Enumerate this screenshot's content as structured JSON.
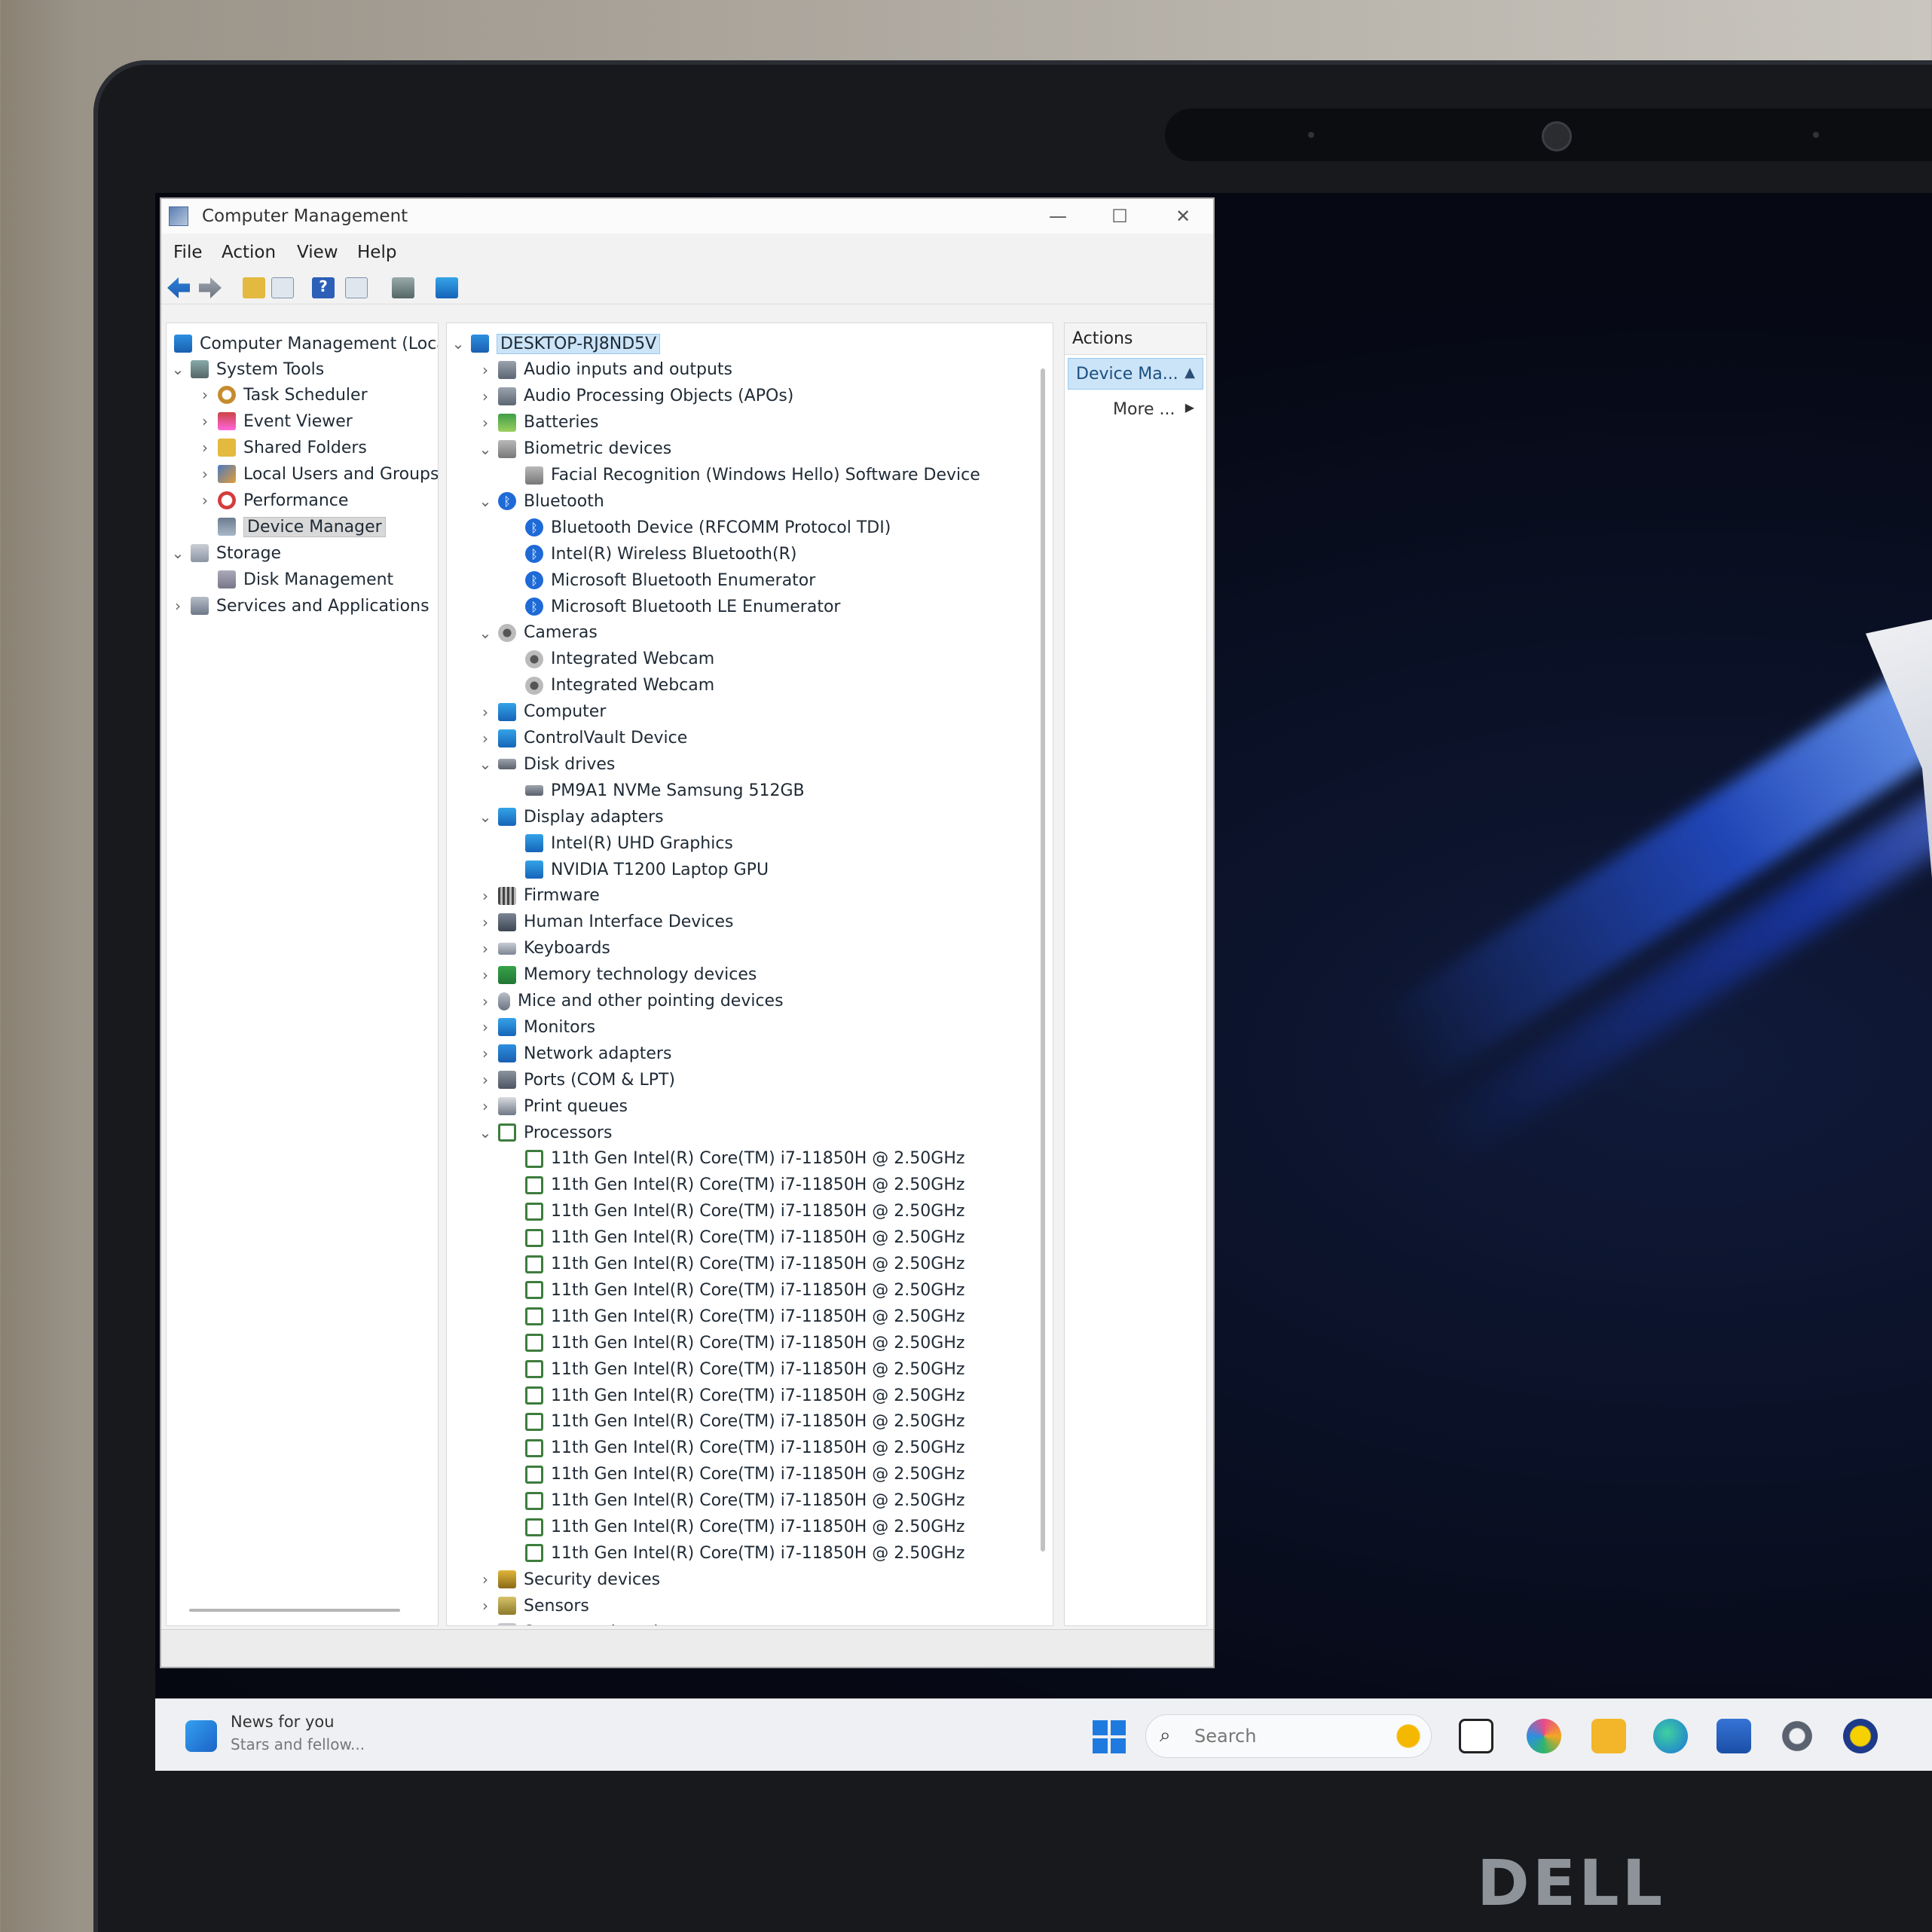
{
  "window": {
    "title": "Computer Management",
    "controls": {
      "minimize": "—",
      "maximize": "☐",
      "close": "✕"
    }
  },
  "menu": [
    "File",
    "Action",
    "View",
    "Help"
  ],
  "left_tree": [
    {
      "label": "Computer Management (Local",
      "level": 0,
      "chevron": "",
      "icon": "computer-icon"
    },
    {
      "label": "System Tools",
      "level": 1,
      "chevron": "⌄",
      "icon": "tools-icon"
    },
    {
      "label": "Task Scheduler",
      "level": 2,
      "chevron": "›",
      "icon": "clock-icon"
    },
    {
      "label": "Event Viewer",
      "level": 2,
      "chevron": "›",
      "icon": "event-icon"
    },
    {
      "label": "Shared Folders",
      "level": 2,
      "chevron": "›",
      "icon": "folder-icon"
    },
    {
      "label": "Local Users and Groups",
      "level": 2,
      "chevron": "›",
      "icon": "users-icon"
    },
    {
      "label": "Performance",
      "level": 2,
      "chevron": "›",
      "icon": "performance-icon"
    },
    {
      "label": "Device Manager",
      "level": 2,
      "chevron": "",
      "icon": "device-manager-icon",
      "selected": true
    },
    {
      "label": "Storage",
      "level": 1,
      "chevron": "⌄",
      "icon": "storage-icon"
    },
    {
      "label": "Disk Management",
      "level": 2,
      "chevron": "",
      "icon": "disk-icon"
    },
    {
      "label": "Services and Applications",
      "level": 1,
      "chevron": "›",
      "icon": "services-icon"
    }
  ],
  "device_tree": [
    {
      "label": "DESKTOP-RJ8ND5V",
      "level": 0,
      "chevron": "⌄",
      "icon": "computer-icon",
      "selected": true
    },
    {
      "label": "Audio inputs and outputs",
      "level": 1,
      "chevron": "›",
      "icon": "speaker-icon"
    },
    {
      "label": "Audio Processing Objects (APOs)",
      "level": 1,
      "chevron": "›",
      "icon": "speaker-icon"
    },
    {
      "label": "Batteries",
      "level": 1,
      "chevron": "›",
      "icon": "battery-icon"
    },
    {
      "label": "Biometric devices",
      "level": 1,
      "chevron": "⌄",
      "icon": "biometric-icon"
    },
    {
      "label": "Facial Recognition (Windows Hello) Software Device",
      "level": 2,
      "chevron": "",
      "icon": "biometric-icon"
    },
    {
      "label": "Bluetooth",
      "level": 1,
      "chevron": "⌄",
      "icon": "bluetooth-icon"
    },
    {
      "label": "Bluetooth Device (RFCOMM Protocol TDI)",
      "level": 2,
      "chevron": "",
      "icon": "bluetooth-icon"
    },
    {
      "label": "Intel(R) Wireless Bluetooth(R)",
      "level": 2,
      "chevron": "",
      "icon": "bluetooth-icon"
    },
    {
      "label": "Microsoft Bluetooth Enumerator",
      "level": 2,
      "chevron": "",
      "icon": "bluetooth-icon"
    },
    {
      "label": "Microsoft Bluetooth LE Enumerator",
      "level": 2,
      "chevron": "",
      "icon": "bluetooth-icon"
    },
    {
      "label": "Cameras",
      "level": 1,
      "chevron": "⌄",
      "icon": "camera-icon"
    },
    {
      "label": "Integrated Webcam",
      "level": 2,
      "chevron": "",
      "icon": "camera-icon"
    },
    {
      "label": "Integrated Webcam",
      "level": 2,
      "chevron": "",
      "icon": "camera-icon"
    },
    {
      "label": "Computer",
      "level": 1,
      "chevron": "›",
      "icon": "monitor-icon"
    },
    {
      "label": "ControlVault Device",
      "level": 1,
      "chevron": "›",
      "icon": "monitor-icon"
    },
    {
      "label": "Disk drives",
      "level": 1,
      "chevron": "⌄",
      "icon": "drive-icon"
    },
    {
      "label": "PM9A1 NVMe Samsung 512GB",
      "level": 2,
      "chevron": "",
      "icon": "drive-icon"
    },
    {
      "label": "Display adapters",
      "level": 1,
      "chevron": "⌄",
      "icon": "monitor-icon"
    },
    {
      "label": "Intel(R) UHD Graphics",
      "level": 2,
      "chevron": "",
      "icon": "monitor-icon"
    },
    {
      "label": "NVIDIA T1200 Laptop GPU",
      "level": 2,
      "chevron": "",
      "icon": "monitor-icon"
    },
    {
      "label": "Firmware",
      "level": 1,
      "chevron": "›",
      "icon": "firmware-icon"
    },
    {
      "label": "Human Interface Devices",
      "level": 1,
      "chevron": "›",
      "icon": "hid-icon"
    },
    {
      "label": "Keyboards",
      "level": 1,
      "chevron": "›",
      "icon": "keyboard-icon"
    },
    {
      "label": "Memory technology devices",
      "level": 1,
      "chevron": "›",
      "icon": "memory-icon"
    },
    {
      "label": "Mice and other pointing devices",
      "level": 1,
      "chevron": "›",
      "icon": "mouse-icon"
    },
    {
      "label": "Monitors",
      "level": 1,
      "chevron": "›",
      "icon": "monitor-icon"
    },
    {
      "label": "Network adapters",
      "level": 1,
      "chevron": "›",
      "icon": "network-icon"
    },
    {
      "label": "Ports (COM & LPT)",
      "level": 1,
      "chevron": "›",
      "icon": "port-icon"
    },
    {
      "label": "Print queues",
      "level": 1,
      "chevron": "›",
      "icon": "printer-icon"
    },
    {
      "label": "Processors",
      "level": 1,
      "chevron": "⌄",
      "icon": "processor-icon"
    },
    {
      "label": "11th Gen Intel(R) Core(TM) i7-11850H @ 2.50GHz",
      "level": 2,
      "chevron": "",
      "icon": "processor-icon"
    },
    {
      "label": "11th Gen Intel(R) Core(TM) i7-11850H @ 2.50GHz",
      "level": 2,
      "chevron": "",
      "icon": "processor-icon"
    },
    {
      "label": "11th Gen Intel(R) Core(TM) i7-11850H @ 2.50GHz",
      "level": 2,
      "chevron": "",
      "icon": "processor-icon"
    },
    {
      "label": "11th Gen Intel(R) Core(TM) i7-11850H @ 2.50GHz",
      "level": 2,
      "chevron": "",
      "icon": "processor-icon"
    },
    {
      "label": "11th Gen Intel(R) Core(TM) i7-11850H @ 2.50GHz",
      "level": 2,
      "chevron": "",
      "icon": "processor-icon"
    },
    {
      "label": "11th Gen Intel(R) Core(TM) i7-11850H @ 2.50GHz",
      "level": 2,
      "chevron": "",
      "icon": "processor-icon"
    },
    {
      "label": "11th Gen Intel(R) Core(TM) i7-11850H @ 2.50GHz",
      "level": 2,
      "chevron": "",
      "icon": "processor-icon"
    },
    {
      "label": "11th Gen Intel(R) Core(TM) i7-11850H @ 2.50GHz",
      "level": 2,
      "chevron": "",
      "icon": "processor-icon"
    },
    {
      "label": "11th Gen Intel(R) Core(TM) i7-11850H @ 2.50GHz",
      "level": 2,
      "chevron": "",
      "icon": "processor-icon"
    },
    {
      "label": "11th Gen Intel(R) Core(TM) i7-11850H @ 2.50GHz",
      "level": 2,
      "chevron": "",
      "icon": "processor-icon"
    },
    {
      "label": "11th Gen Intel(R) Core(TM) i7-11850H @ 2.50GHz",
      "level": 2,
      "chevron": "",
      "icon": "processor-icon"
    },
    {
      "label": "11th Gen Intel(R) Core(TM) i7-11850H @ 2.50GHz",
      "level": 2,
      "chevron": "",
      "icon": "processor-icon"
    },
    {
      "label": "11th Gen Intel(R) Core(TM) i7-11850H @ 2.50GHz",
      "level": 2,
      "chevron": "",
      "icon": "processor-icon"
    },
    {
      "label": "11th Gen Intel(R) Core(TM) i7-11850H @ 2.50GHz",
      "level": 2,
      "chevron": "",
      "icon": "processor-icon"
    },
    {
      "label": "11th Gen Intel(R) Core(TM) i7-11850H @ 2.50GHz",
      "level": 2,
      "chevron": "",
      "icon": "processor-icon"
    },
    {
      "label": "11th Gen Intel(R) Core(TM) i7-11850H @ 2.50GHz",
      "level": 2,
      "chevron": "",
      "icon": "processor-icon"
    },
    {
      "label": "Security devices",
      "level": 1,
      "chevron": "›",
      "icon": "security-icon"
    },
    {
      "label": "Sensors",
      "level": 1,
      "chevron": "›",
      "icon": "sensor-icon"
    },
    {
      "label": "Smart card readers",
      "level": 1,
      "chevron": "›",
      "icon": "smartcard-icon"
    }
  ],
  "actions": {
    "header": "Actions",
    "selected": "Device Ma...",
    "more": "More ..."
  },
  "taskbar": {
    "news_title": "News for you",
    "news_subtitle": "Stars and fellow...",
    "search_placeholder": "Search"
  },
  "brand": "DELL"
}
